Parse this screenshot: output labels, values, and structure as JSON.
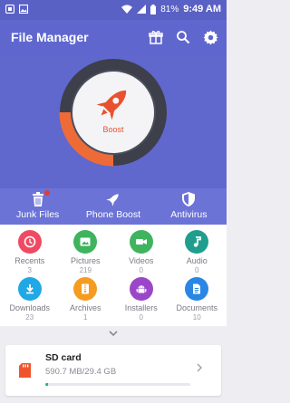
{
  "status_bar": {
    "battery": "81%",
    "time": "9:49 AM"
  },
  "app_bar": {
    "title": "File Manager"
  },
  "boost": {
    "label": "Boost",
    "gauge_fraction": 0.25,
    "gauge_color": "#ee6b37"
  },
  "quick_actions": [
    {
      "label": "Junk Files"
    },
    {
      "label": "Phone Boost"
    },
    {
      "label": "Antivirus"
    }
  ],
  "categories": [
    {
      "name": "Recents",
      "count": "3",
      "color": "#ef4a64",
      "icon": "clock-icon"
    },
    {
      "name": "Pictures",
      "count": "219",
      "color": "#3fb45e",
      "icon": "picture-icon"
    },
    {
      "name": "Videos",
      "count": "0",
      "color": "#3fb45e",
      "icon": "video-icon"
    },
    {
      "name": "Audio",
      "count": "0",
      "color": "#1f9e8d",
      "icon": "music-icon"
    },
    {
      "name": "Downloads",
      "count": "23",
      "color": "#20a8e6",
      "icon": "download-icon"
    },
    {
      "name": "Archives",
      "count": "1",
      "color": "#f59c20",
      "icon": "archive-icon"
    },
    {
      "name": "Installers",
      "count": "0",
      "color": "#9b46c9",
      "icon": "android-icon"
    },
    {
      "name": "Documents",
      "count": "10",
      "color": "#2a86e3",
      "icon": "document-icon"
    }
  ],
  "storage": {
    "name": "SD card",
    "size_text": "590.7 MB/29.4 GB",
    "used_fraction": 0.02,
    "fill_color": "#2bb673"
  }
}
